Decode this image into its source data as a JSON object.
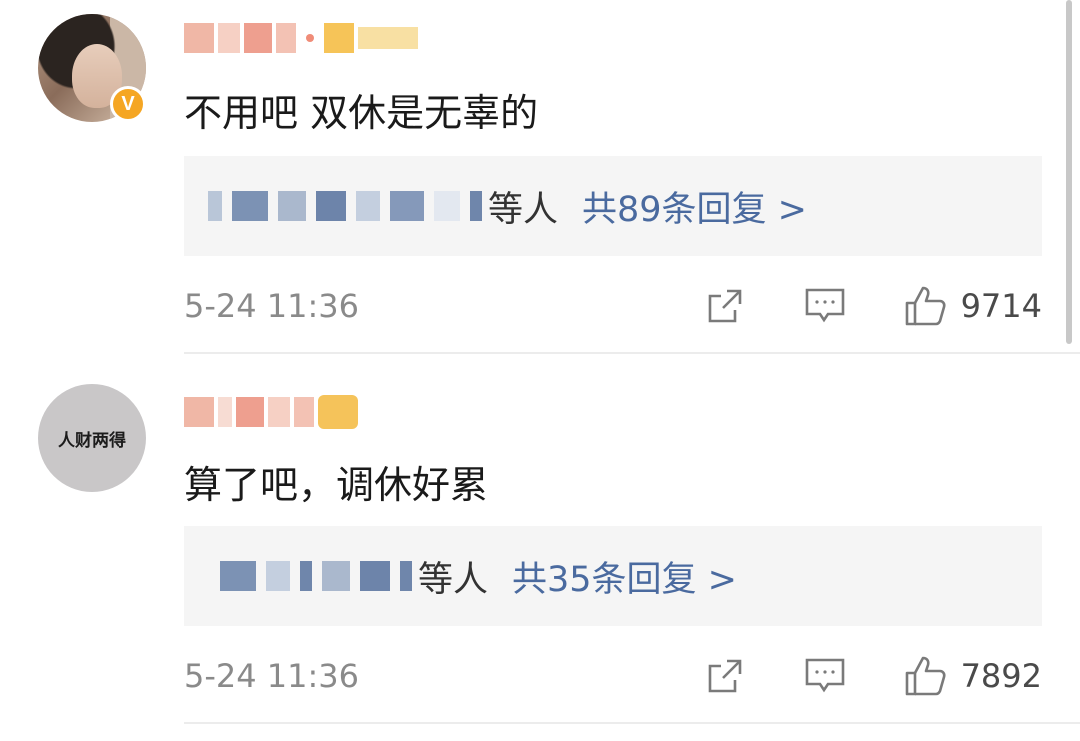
{
  "comments": [
    {
      "avatar_desc": "photo-avatar",
      "verified": true,
      "verified_glyph": "V",
      "content": "不用吧 双休是无辜的",
      "reply_others": "等人",
      "reply_count": "共89条回复 >",
      "timestamp": "5-24 11:36",
      "like_count": "9714"
    },
    {
      "avatar_text": "人财两得",
      "verified": false,
      "content": "算了吧，调休好累",
      "reply_others": "等人",
      "reply_count": "共35条回复 >",
      "timestamp": "5-24 11:36",
      "like_count": "7892"
    }
  ],
  "icons": {
    "share": "share-icon",
    "comment": "comment-icon",
    "like": "thumbs-up-icon",
    "verified": "verified-badge-icon"
  },
  "colors": {
    "link": "#4a6a9f",
    "meta": "#8a8a8a",
    "reply_bg": "#f5f5f5",
    "verified": "#f5a623"
  }
}
